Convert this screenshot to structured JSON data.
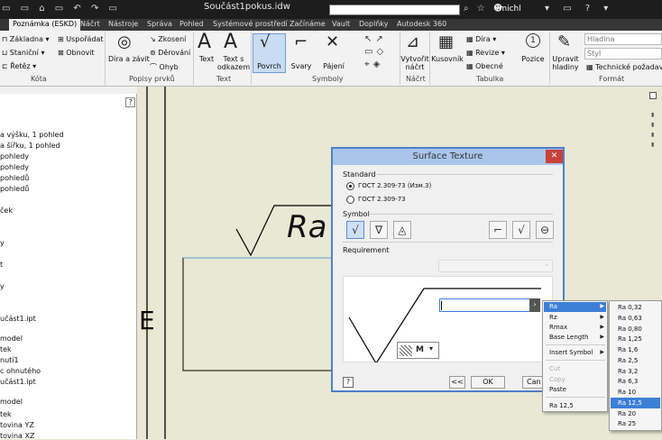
{
  "window": {
    "document_title": "Součást1pokus.idw",
    "user": "vmichl"
  },
  "tabs": [
    "Poznámka (ESKD)",
    "Náčrt",
    "Nástroje",
    "Správa",
    "Pohled",
    "Systémové prostředí",
    "Začínáme",
    "Vault",
    "Doplňky",
    "Autodesk 360"
  ],
  "ribbon": {
    "kota": {
      "zakladna": "Základna",
      "stanicni": "Staniční",
      "retez": "Řetěz",
      "usporadat": "Uspořádat",
      "obnovit": "Obnovit",
      "label": "Kóta"
    },
    "popisy": {
      "dira_a_zavit": "Díra a závit",
      "zkoseni": "Zkosení",
      "derovani": "Děrování",
      "ohyb": "Ohyb",
      "label": "Popisy prvků"
    },
    "text": {
      "text": "Text",
      "text_s_odkazem": [
        "Text s",
        "odkazem"
      ],
      "label": "Text"
    },
    "symboly": {
      "povrch": "Povrch",
      "svary": "Svary",
      "pajeni": "Pájení",
      "label": "Symboly"
    },
    "nacrt": {
      "vytvorit_nacrt": [
        "Vytvořit",
        "náčrt"
      ],
      "label": "Náčrt"
    },
    "tabulka": {
      "kusovnik": "Kusovník",
      "dira": "Díra",
      "revize": "Revize",
      "obecne": "Obecné",
      "label": "Tabulka"
    },
    "pozice": {
      "pozice": "Pozice",
      "badge": "1"
    },
    "format": {
      "upravit_hladiny": [
        "Upravit",
        "hladiny"
      ],
      "hladina_placeholder": "Hladina",
      "styl_placeholder": "Styl",
      "technicke_pozadavky": "Technické požadavk",
      "label": "Formát"
    }
  },
  "tree_items": [
    "a výšku, 1 pohled",
    "a šířku, 1 pohled",
    "pohledy",
    "pohledy",
    "pohledů",
    "pohledů",
    "ček",
    "y",
    "t",
    "y",
    "učást1.ipt",
    "model",
    "tek",
    "nutí1",
    "c ohnutého",
    "učást1.ipt",
    "model",
    "tek",
    "tovina YZ",
    "tovina XZ"
  ],
  "canvas": {
    "ra_text": "Ra",
    "view_letter": "E"
  },
  "dialog": {
    "title": "Surface Texture",
    "standard_label": "Standard",
    "standard_options": [
      "ГОСТ 2.309-73 (Изм.3)",
      "ГОСТ 2.309-73"
    ],
    "standard_selected": 0,
    "symbol_label": "Symbol",
    "requirement_label": "Requirement",
    "marking": "M",
    "buttons": {
      "collapse": "<<",
      "ok": "OK",
      "cancel": "Can"
    },
    "help": "?"
  },
  "context_menu": {
    "items": [
      "Ra",
      "Rz",
      "Rmax",
      "Base Length",
      "Insert Symbol",
      "Cut",
      "Copy",
      "Paste",
      "Ra 12,5"
    ],
    "disabled": [
      "Cut",
      "Copy"
    ],
    "highlighted": "Ra"
  },
  "submenu": {
    "items": [
      "Ra 0,32",
      "Ra 0,63",
      "Ra 0,80",
      "Ra 1,25",
      "Ra 1,6",
      "Ra 2,5",
      "Ra 3,2",
      "Ra 6,3",
      "Ra 10",
      "Ra 12,5",
      "Ra 20",
      "Ra 25"
    ],
    "highlighted": "Ra 12,5"
  },
  "colors": {
    "accent": "#3d7fd6",
    "titlebar": "#1d1d1d",
    "canvas": "#e8e8d4",
    "dialog_border": "#4d80c8"
  }
}
